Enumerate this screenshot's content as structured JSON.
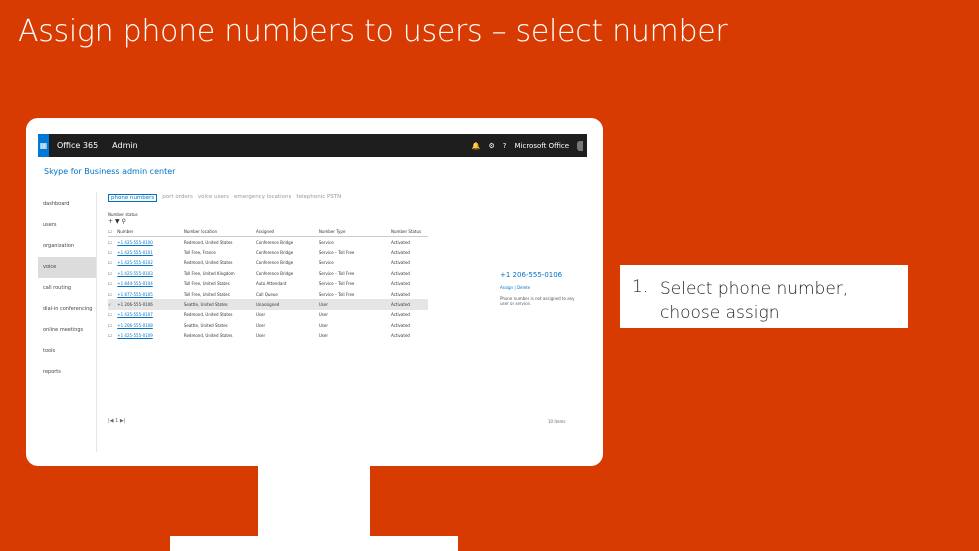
{
  "slide": {
    "title": "Assign phone numbers to users – select number",
    "callout": {
      "number": "1.",
      "text": "Select phone number, choose assign"
    }
  },
  "window": {
    "app_name": "Office 365",
    "section": "Admin",
    "user": "Microsoft Office",
    "admin_center_title": "Skype for Business admin center"
  },
  "nav": {
    "items": [
      {
        "label": "dashboard",
        "selected": false
      },
      {
        "label": "users",
        "selected": false
      },
      {
        "label": "organization",
        "selected": false
      },
      {
        "label": "voice",
        "selected": true
      },
      {
        "label": "call routing",
        "selected": false
      },
      {
        "label": "dial-in conferencing",
        "selected": false
      },
      {
        "label": "online meetings",
        "selected": false
      },
      {
        "label": "tools",
        "selected": false
      },
      {
        "label": "reports",
        "selected": false
      }
    ]
  },
  "tabs": [
    {
      "label": "phone numbers",
      "selected": true
    },
    {
      "label": "port orders",
      "selected": false
    },
    {
      "label": "voice users",
      "selected": false
    },
    {
      "label": "emergency locations",
      "selected": false
    },
    {
      "label": "telephonic PSTN",
      "selected": false
    }
  ],
  "table": {
    "filter": "Number status",
    "columns": [
      "Number",
      "Number location",
      "Assigned",
      "Number Type",
      "Number Status"
    ],
    "rows": [
      {
        "number": "+1 425-555-0100",
        "location": "Redmond, United States",
        "assigned": "Conference Bridge",
        "type": "Service",
        "status": "Activated",
        "selected": false
      },
      {
        "number": "+1 425-555-0101",
        "location": "Toll Free, France",
        "assigned": "Conference Bridge",
        "type": "Service – Toll Free",
        "status": "Activated",
        "selected": false
      },
      {
        "number": "+1 425-555-0102",
        "location": "Redmond, United States",
        "assigned": "Conference Bridge",
        "type": "Service",
        "status": "Activated",
        "selected": false
      },
      {
        "number": "+1 425-555-0103",
        "location": "Toll Free, United Kingdom",
        "assigned": "Conference Bridge",
        "type": "Service – Toll Free",
        "status": "Activated",
        "selected": false
      },
      {
        "number": "+1 844-555-0104",
        "location": "Toll Free, United States",
        "assigned": "Auto Attendant",
        "type": "Service – Toll Free",
        "status": "Activated",
        "selected": false
      },
      {
        "number": "+1 877-555-0105",
        "location": "Toll Free, United States",
        "assigned": "Call Queue",
        "type": "Service – Toll Free",
        "status": "Activated",
        "selected": false
      },
      {
        "number": "+1 206-555-0106",
        "location": "Seattle, United States",
        "assigned": "Unassigned",
        "type": "User",
        "status": "Activated",
        "selected": true
      },
      {
        "number": "+1 425-555-0107",
        "location": "Redmond, United States",
        "assigned": "User",
        "type": "User",
        "status": "Activated",
        "selected": false
      },
      {
        "number": "+1 206-555-0108",
        "location": "Seattle, United States",
        "assigned": "User",
        "type": "User",
        "status": "Activated",
        "selected": false
      },
      {
        "number": "+1 425-555-0109",
        "location": "Redmond, United States",
        "assigned": "User",
        "type": "User",
        "status": "Activated",
        "selected": false
      }
    ],
    "pager": "1",
    "total": "10 items"
  },
  "details": {
    "number": "+1 206-555-0106",
    "actions": "Assign | Delete",
    "note": "Phone number is not assigned to any user or service."
  }
}
